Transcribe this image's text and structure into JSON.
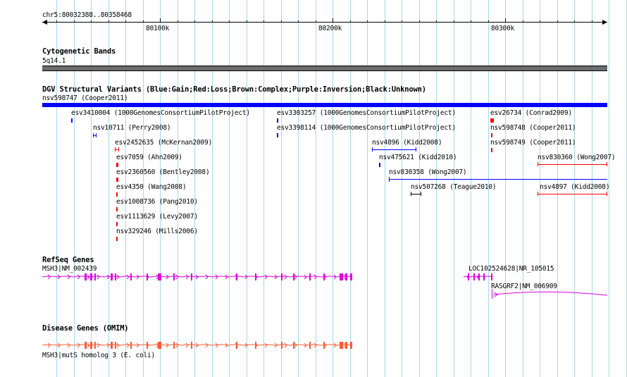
{
  "ruler": {
    "position": "chr5:80032388..80358468",
    "ticks": [
      "80100k",
      "80200k",
      "80300k"
    ]
  },
  "tracks": {
    "cytoband": {
      "title": "Cytogenetic Bands",
      "band": "5q14.1"
    },
    "dgv": {
      "title": "DGV Structural Variants (Blue:Gain;Red:Loss;Brown:Complex;Purple:Inversion;Black:Unknown)",
      "top_feature": "nsv598747 (Cooper2011)",
      "features": [
        "esv3410004 (1000GenomesConsortiumPilotProject)",
        "nsv10711 (Perry2008)",
        "esv2452635 (McKernan2009)",
        "esv7059 (Ahn2009)",
        "esv2360560 (Bentley2008)",
        "esv4350 (Wang2008)",
        "esv1008736 (Pang2010)",
        "esv1113629 (Levy2007)",
        "nsv329246 (Mills2006)",
        "esv3303257 (1000GenomesConsortiumPilotProject)",
        "esv3398114 (1000GenomesConsortiumPilotProject)",
        "nsv4896 (Kidd2008)",
        "nsv475621 (Kidd2010)",
        "nsv830358 (Wong2007)",
        "nsv507268 (Teague2010)",
        "esv26734 (Conrad2009)",
        "nsv598748 (Cooper2011)",
        "nsv598749 (Cooper2011)",
        "nsv830360 (Wong2007)",
        "nsv4897 (Kidd2008)"
      ]
    },
    "refseq": {
      "title": "RefSeq Genes",
      "genes": [
        "MSH3|NM_002439",
        "LOC102524628|NR_105015",
        "RASGRF2|NM_006909"
      ]
    },
    "disease": {
      "title": "Disease Genes (OMIM)",
      "genes": [
        "MSH3|mutS homolog 3 (E. coli)"
      ]
    }
  },
  "colors": {
    "grid": "#a8d8ec",
    "gain": "#0000ff",
    "loss": "#ff0000",
    "unknown": "#000000",
    "refseq": "#dd00dd",
    "omim": "#ff5a32",
    "cytoband": "#6c6c6c"
  }
}
